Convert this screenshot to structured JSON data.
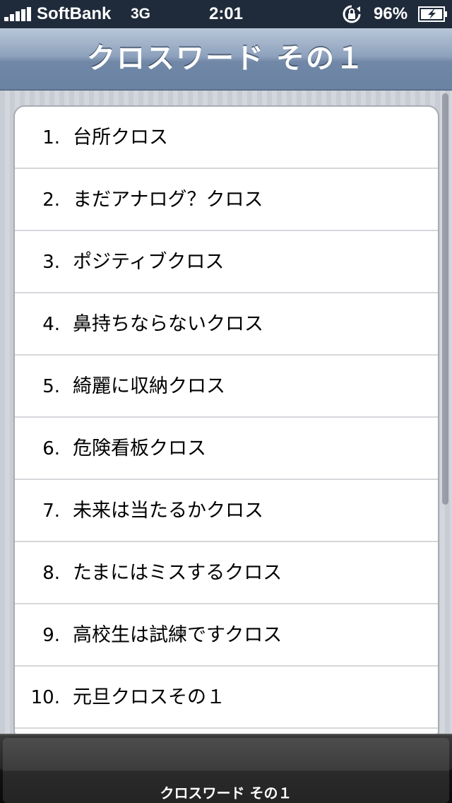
{
  "status_bar": {
    "carrier": "SoftBank",
    "network": "3G",
    "time": "2:01",
    "battery_percent": "96%",
    "icons": [
      "signal-bars-icon",
      "rotation-lock-icon",
      "battery-charging-icon"
    ]
  },
  "nav_bar": {
    "title": "クロスワード その１"
  },
  "list": {
    "items": [
      {
        "number": "1.",
        "label": "台所クロス"
      },
      {
        "number": "2.",
        "label": "まだアナログ？クロス"
      },
      {
        "number": "3.",
        "label": "ポジティブクロス"
      },
      {
        "number": "4.",
        "label": "鼻持ちならないクロス"
      },
      {
        "number": "5.",
        "label": "綺麗に収納クロス"
      },
      {
        "number": "6.",
        "label": "危険看板クロス"
      },
      {
        "number": "7.",
        "label": "未来は当たるかクロス"
      },
      {
        "number": "8.",
        "label": "たまにはミスするクロス"
      },
      {
        "number": "9.",
        "label": "高校生は試練ですクロス"
      },
      {
        "number": "10.",
        "label": "元旦クロスその１"
      }
    ]
  },
  "tab_bar": {
    "tabs": [
      {
        "label": "クロスワード その１",
        "selected": true
      }
    ]
  }
}
